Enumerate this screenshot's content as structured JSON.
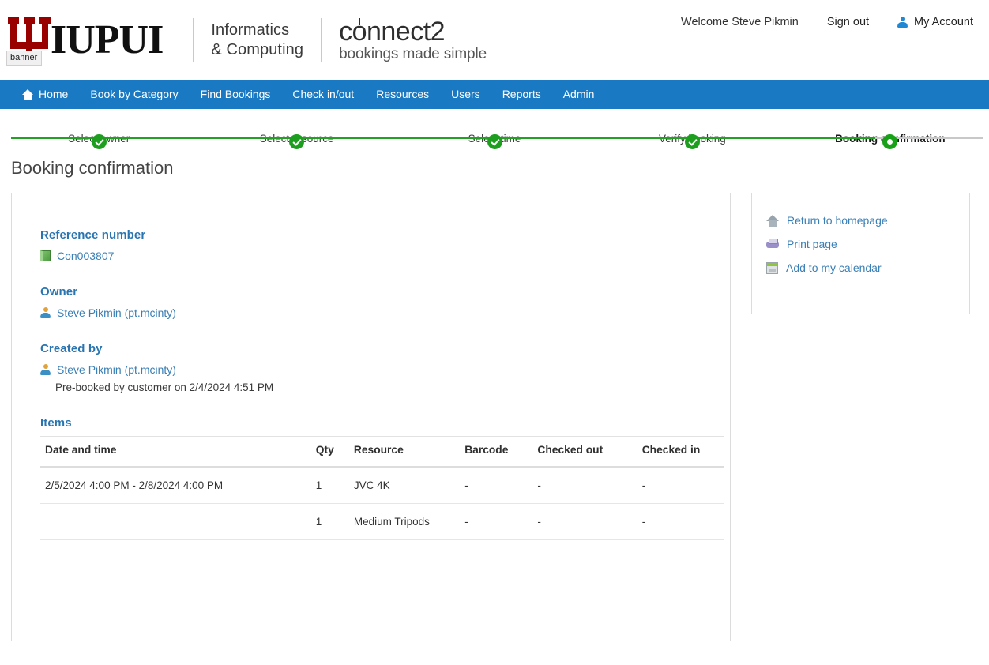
{
  "header": {
    "logo_alt_tooltip": "banner",
    "iupui_wordmark": "IUPUI",
    "school_line1": "Informatics",
    "school_line2": "& Computing",
    "product_name": "connect2",
    "product_tagline": "bookings made simple",
    "welcome": "Welcome Steve Pikmin",
    "sign_out": "Sign out",
    "my_account": "My Account",
    "account_icon": "person-icon"
  },
  "nav": {
    "items": [
      {
        "label": "Home",
        "icon": "home-icon"
      },
      {
        "label": "Book by Category",
        "icon": ""
      },
      {
        "label": "Find Bookings",
        "icon": ""
      },
      {
        "label": "Check in/out",
        "icon": ""
      },
      {
        "label": "Resources",
        "icon": ""
      },
      {
        "label": "Users",
        "icon": ""
      },
      {
        "label": "Reports",
        "icon": ""
      },
      {
        "label": "Admin",
        "icon": ""
      }
    ]
  },
  "stepper": {
    "steps": [
      {
        "label": "Select owner",
        "state": "complete"
      },
      {
        "label": "Select resource",
        "state": "complete"
      },
      {
        "label": "Select time",
        "state": "complete"
      },
      {
        "label": "Verify booking",
        "state": "complete"
      },
      {
        "label": "Booking confirmation",
        "state": "current"
      }
    ],
    "complete_color": "#22a122",
    "incomplete_color": "#c8c8c8"
  },
  "page": {
    "title": "Booking confirmation"
  },
  "booking": {
    "reference_heading": "Reference number",
    "reference_value": "Con003807",
    "reference_icon": "book-icon",
    "owner_heading": "Owner",
    "owner_value": "Steve Pikmin (pt.mcinty)",
    "owner_icon": "person-icon",
    "created_by_heading": "Created by",
    "created_by_value": "Steve Pikmin (pt.mcinty)",
    "created_by_icon": "person-icon",
    "created_note": "Pre-booked by customer on 2/4/2024 4:51 PM",
    "items_heading": "Items",
    "items_table": {
      "columns": [
        "Date and time",
        "Qty",
        "Resource",
        "Barcode",
        "Checked out",
        "Checked in"
      ],
      "rows": [
        {
          "date_time": "2/5/2024 4:00 PM - 2/8/2024 4:00 PM",
          "qty": "1",
          "resource": "JVC 4K",
          "barcode": "-",
          "checked_out": "-",
          "checked_in": "-"
        },
        {
          "date_time": "",
          "qty": "1",
          "resource": "Medium Tripods",
          "barcode": "-",
          "checked_out": "-",
          "checked_in": "-"
        }
      ]
    }
  },
  "side_panel": {
    "links": [
      {
        "label": "Return to homepage",
        "icon": "home-icon"
      },
      {
        "label": "Print page",
        "icon": "printer-icon"
      },
      {
        "label": "Add to my calendar",
        "icon": "calendar-icon"
      }
    ]
  },
  "colors": {
    "nav_blue": "#1979c3",
    "link_blue": "#3a7fb5",
    "heading_blue": "#2a75b0",
    "step_green": "#22a122",
    "iu_crimson": "#990000"
  }
}
